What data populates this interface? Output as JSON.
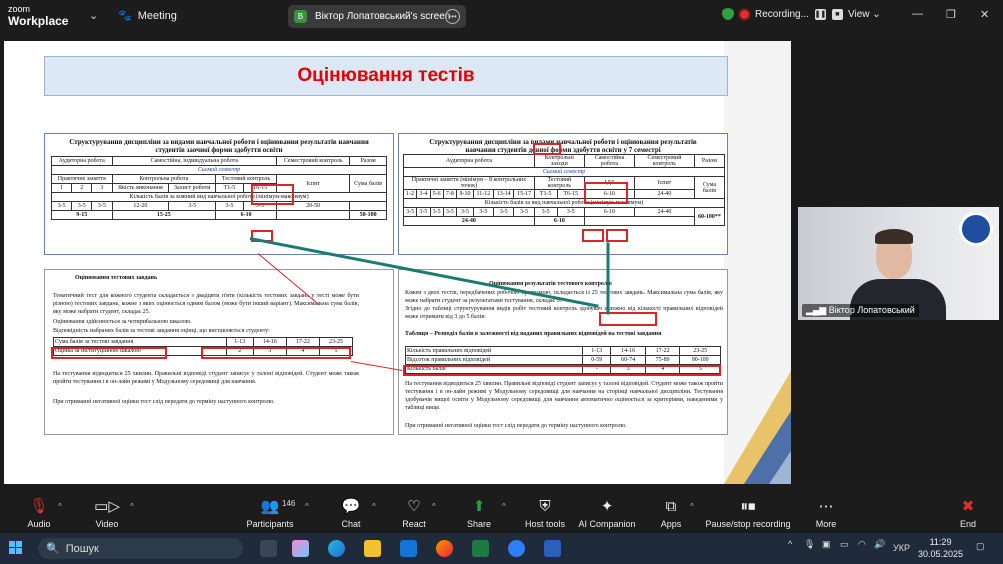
{
  "topbar": {
    "zoom_logo_top": "zoom",
    "zoom_logo_bottom": "Workplace",
    "meeting_label": "Meeting",
    "screen_badge": "В",
    "screen_title": "Віктор Лопатовський's screen",
    "recording_label": "Recording...",
    "view_label": "View"
  },
  "slide": {
    "title": "Оцінювання тестів",
    "left_table_title": "Структурування дисципліни за видами навчальної роботи і оцінювання результатів навчання студентів заочної форми здобуття освіти",
    "left_headers": [
      "Аудиторна робота",
      "Самостійна, індивідуальна робота",
      "Семестровий контроль",
      "Разом"
    ],
    "left_semester": "Сьомий семестр",
    "left_sub": [
      "Практичне заняття",
      "Контрольна робота",
      "Тестовий контроль",
      "Іспит",
      "Сума балів"
    ],
    "left_row_nums": [
      "1",
      "2",
      "3",
      "Якість виконання",
      "Захист роботи",
      "Т1-5",
      "Т6-15"
    ],
    "left_min_max": "Кількість балів за кожний вид навчальної роботи (мінімум-максимум)",
    "left_vals": [
      "3-5",
      "3-5",
      "3-5",
      "12-20",
      "3-5",
      "3-5",
      "3-5",
      "20-50",
      ""
    ],
    "left_totals": [
      "9-15",
      "15-25",
      "6-10",
      "",
      "50-100"
    ],
    "right_table_title": "Структурування дисципліни за видами навчальної роботи і оцінювання результатів навчання студентів денної форми здобуття освіти у 7 семестрі",
    "right_headers": [
      "Аудиторна робота",
      "Контрольні заходи",
      "Самостійна робота",
      "Семестровий контроль",
      "Разом"
    ],
    "right_semester": "Сьомий семестр",
    "right_sub": [
      "Практичні заняття (мінімум – 8 контрольних точок)",
      "Тестовий контроль",
      "ІДЗ",
      "Іспит",
      "Сума балів"
    ],
    "right_nums": [
      "1-2",
      "3-4",
      "5-6",
      "7-8",
      "9-10",
      "11-12",
      "13-14",
      "15-17",
      "Т1-5",
      "Т6-15",
      "6-10",
      "24-40"
    ],
    "right_min_max": "Кількість балів за вид навчальної роботи (мінімум-максимум)",
    "right_vals": [
      "3-5",
      "3-5",
      "3-5",
      "3-5",
      "3-5",
      "3-5",
      "3-5",
      "3-5",
      "3-5",
      "3-5"
    ],
    "right_totals": [
      "24-40",
      "6-10",
      "6-10",
      "24-40",
      "60-100**"
    ],
    "bl_heading": "Оцінювання тестових завдань",
    "bl_p1": "Тематичний тест для кожного студента складається з двадцяти п'яти (кількість тестових завдань у тесті може бути різною) тестових завдань, кожне з яких оцінюється одним балом (може бути інший варіант). Максимальна сума балів, яку може набрати студент, складає 25.",
    "bl_p2": "Оцінювання здійснюється за чотирибальною шкалою.",
    "bl_p3": "Відповідність набраних балів за тестові завдання оцінці, що виставляється студенту:",
    "bl_table": [
      [
        "Сума балів за тестові завдання",
        "1-13",
        "14-16",
        "17-22",
        "23-25"
      ],
      [
        "Оцінка за інституційною шкалою",
        "2",
        "3",
        "4",
        "5"
      ]
    ],
    "bl_p4": "На тестування відводиться 25 хвилин. Правильні відповіді студент записує у талоні відповідей. Студент може також пройти тестування і в он-лайн режимі у Модульному середовищі для навчання.",
    "bl_p5": "При отриманні негативної оцінки тест слід передати до терміну наступного контролю.",
    "br_heading": "Оцінювання результатів тестового контролю",
    "br_p1": "Кожен з двох тестів, передбачених робочою програмою, складається із 25 тестових завдань. Максимальна сума балів, яку може набрати студент за результатами тестування, складає 5.",
    "br_p2": "Згідно до таблиці структурування видів робіт тестовий контроль здобувач залежно від кількості правильних відповідей може отримати від 3 до 5 балів:",
    "br_table_caption": "Таблиця – Розподіл балів в залежності від наданих правильних відповідей на тестові завдання",
    "br_table": [
      [
        "Кількість правильних відповідей",
        "1-13",
        "14-16",
        "17-22",
        "23-25"
      ],
      [
        "Відсоток правильних відповідей",
        "0-59",
        "60-74",
        "75-89",
        "90-100"
      ],
      [
        "Кількість балів",
        "-",
        "3",
        "4",
        "5"
      ]
    ],
    "br_p3": "На тестування відводиться 25 хвилин. Правильні відповіді студент записує у талоні відповідей. Студент може також пройти тестування і в он-лайн режимі у Модульному середовищі для навчання на сторінці навчальної дисципліни. Тестування здобувачів вищої освіти у Модульному середовищі для навчання автоматично оцінюється за критеріями, наведеними у таблиці вище.",
    "br_p4": "При отриманні негативної оцінки тест слід передати до терміну наступного контролю."
  },
  "video": {
    "participant_name": "Віктор Лопатовський"
  },
  "toolbar": {
    "audio": "Audio",
    "video": "Video",
    "participants": "Participants",
    "participants_count": "146",
    "chat": "Chat",
    "react": "React",
    "share": "Share",
    "host_tools": "Host tools",
    "ai_companion": "AI Companion",
    "apps": "Apps",
    "pause_rec": "Pause/stop recording",
    "more": "More",
    "end": "End"
  },
  "taskbar": {
    "search_placeholder": "Пошук",
    "language": "УКР",
    "time": "11:29",
    "date": "30.05.2025"
  }
}
